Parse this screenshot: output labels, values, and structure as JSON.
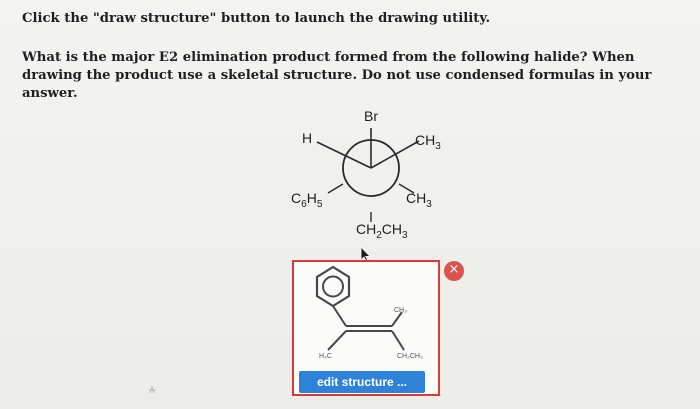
{
  "instruction": "Click the \"draw structure\" button to launch the drawing utility.",
  "question": "What is the major E2 elimination product formed from the following halide? When drawing the product use a skeletal structure. Do not use condensed formulas in your answer.",
  "newman_projection": {
    "top": "Br",
    "front_left": "H",
    "front_right_base": "CH",
    "front_right_sub": "3",
    "back_left_base": "C",
    "back_left_sub1": "6",
    "back_left_mid": "H",
    "back_left_sub2": "5",
    "back_right_base": "CH",
    "back_right_sub": "3",
    "bottom_base1": "CH",
    "bottom_sub1": "2",
    "bottom_base2": "CH",
    "bottom_sub2": "3"
  },
  "drawing_widget": {
    "edit_label": "edit structure ...",
    "close_label": "×",
    "preview_labels": {
      "ch3": "CH₃",
      "h3c": "H₃C",
      "ch2ch3": "CH₂CH₃"
    }
  },
  "colors": {
    "accent_button": "#2e82d8",
    "close_button": "#d9534f",
    "widget_border": "#d83a3a"
  }
}
